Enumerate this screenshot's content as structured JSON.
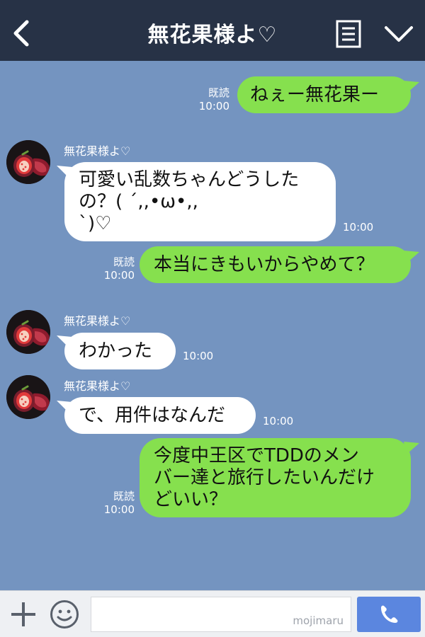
{
  "header": {
    "title": "無花果様よ♡"
  },
  "messages": [
    {
      "side": "right",
      "text": "ねぇー無花果ー",
      "read_label": "既読",
      "time": "10:00"
    },
    {
      "side": "left",
      "sender": "無花果様よ♡",
      "lines": [
        "可愛い乱数ちゃんどうした",
        "の？( ´,,•ω•,,",
        "`)♡"
      ],
      "time": "10:00"
    },
    {
      "side": "right",
      "text": "本当にきもいからやめて？",
      "read_label": "既読",
      "time": "10:00"
    },
    {
      "side": "left",
      "sender": "無花果様よ♡",
      "text": "わかった",
      "time": "10:00"
    },
    {
      "side": "left",
      "sender": "無花果様よ♡",
      "text": "で、用件はなんだ",
      "time": "10:00"
    },
    {
      "side": "right",
      "lines": [
        "今度中王区でTDDのメン",
        "バー達と旅行したいんだけ",
        "どいい？"
      ],
      "read_label": "既読",
      "time": "10:00"
    }
  ],
  "footer": {
    "input_value": "",
    "watermark": "mojimaru"
  },
  "colors": {
    "header_bg": "#273246",
    "chat_bg": "#7494c0",
    "bubble_green": "#86e04e",
    "bubble_white": "#ffffff",
    "call_button": "#5b86df"
  },
  "icons": {
    "back": "chevron-left-icon",
    "menu": "document-list-icon",
    "collapse": "chevron-down-icon",
    "add": "plus-icon",
    "sticker": "smiley-icon",
    "call": "phone-icon",
    "avatar": "fig-icon"
  }
}
